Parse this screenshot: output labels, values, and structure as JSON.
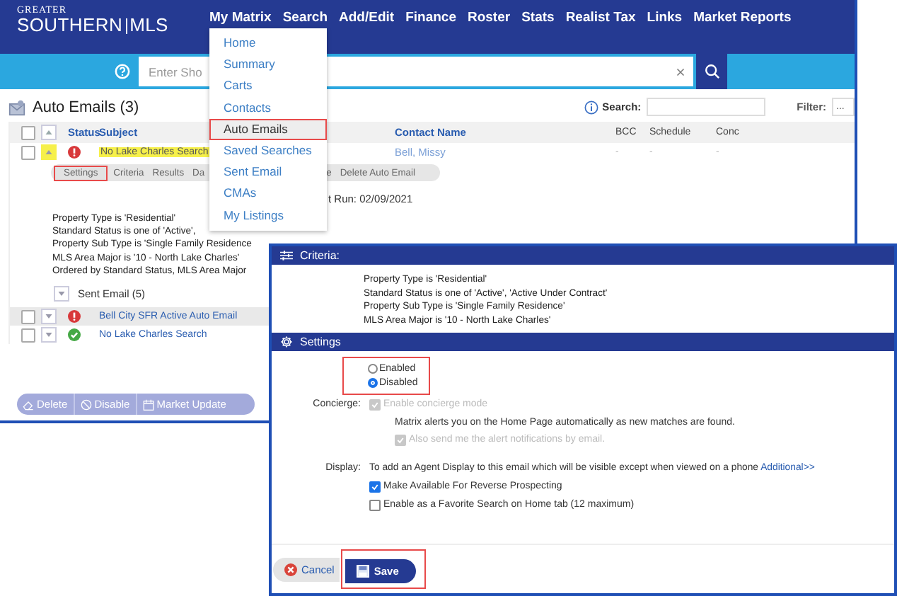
{
  "header": {
    "logo_top": "GREATER",
    "logo_main": "SOUTHERN",
    "logo_suffix": "MLS",
    "nav": [
      "My Matrix",
      "Search",
      "Add/Edit",
      "Finance",
      "Roster",
      "Stats",
      "Realist Tax",
      "Links",
      "Market Reports"
    ]
  },
  "search_bar": {
    "placeholder": "Enter Sho"
  },
  "menu": {
    "items": [
      {
        "label": "Home",
        "selected": false
      },
      {
        "label": "Summary",
        "selected": false
      },
      {
        "label": "Carts",
        "selected": false
      },
      {
        "label": "Contacts",
        "selected": false
      },
      {
        "label": "Auto Emails",
        "selected": true
      },
      {
        "label": "Saved Searches",
        "selected": false
      },
      {
        "label": "Sent Email",
        "selected": false
      },
      {
        "label": "CMAs",
        "selected": false
      },
      {
        "label": "My Listings",
        "selected": false
      }
    ]
  },
  "page": {
    "title": "Auto Emails (3)",
    "search_label": "Search:",
    "filter_label": "Filter:",
    "filter_value": "...",
    "select_all": {
      "checked": false
    },
    "columns": [
      "Status",
      "Subject",
      "Contact Name",
      "BCC",
      "Schedule",
      "Conc"
    ],
    "rows": [
      {
        "kind": "error",
        "subject": "No Lake Charles Search",
        "contact": "Bell, Missy",
        "bcc": "-",
        "schedule": "-",
        "column_6": "-",
        "highlighted": true,
        "expanded": true,
        "selected": false,
        "checked": false
      },
      {
        "kind": "error",
        "subject": "Bell City SFR Active Auto Email",
        "highlighted": false,
        "expanded": false,
        "selected": true,
        "checked": false
      },
      {
        "kind": "ok",
        "subject": "No Lake Charles Search",
        "highlighted": false,
        "expanded": false,
        "selected": false,
        "checked": false
      }
    ],
    "detail": {
      "tabs": [
        {
          "label": "Settings",
          "selected": true
        },
        {
          "label": "Criteria",
          "selected": false
        },
        {
          "label": "Results",
          "selected": false
        },
        {
          "label": "Da",
          "selected": false
        }
      ],
      "tabs_after": [
        {
          "label": "e",
          "selected": false
        },
        {
          "label": "Delete Auto Email",
          "selected": false
        }
      ],
      "last_run": "t Run: 02/09/2021",
      "criteria": [
        "Property Type is 'Residential'",
        "Standard Status is one of 'Active',",
        "Property Sub Type is 'Single Family Residence",
        "MLS Area Major is '10 - North Lake Charles'",
        "Ordered by Standard Status, MLS Area Major"
      ],
      "sent_email": "Sent Email (5)"
    },
    "actions": [
      {
        "label": "Delete",
        "kind": "delete"
      },
      {
        "label": "Disable",
        "kind": "disable"
      },
      {
        "label": "Market Update",
        "kind": "calendar"
      }
    ]
  },
  "dialog": {
    "criteria_title": "Criteria:",
    "criteria": [
      "Property Type is 'Residential'",
      "Standard Status is one of 'Active', 'Active Under Contract'",
      "Property Sub Type is 'Single Family Residence'",
      "MLS Area Major is '10 - North Lake Charles'"
    ],
    "settings_title": "Settings",
    "radio_group": {
      "annotated": true,
      "options": [
        {
          "label": "Enabled",
          "selected": false
        },
        {
          "label": "Disabled",
          "selected": true
        }
      ]
    },
    "concierge": {
      "label": "Concierge:",
      "checkbox": {
        "label": "Enable concierge mode",
        "checked": true,
        "disabled": true
      },
      "note": "Matrix alerts you on the Home Page automatically as new matches are found.",
      "sub_checkbox": {
        "label": "Also send me the alert notifications by email.",
        "checked": true,
        "disabled": true
      }
    },
    "display": {
      "label": "Display:",
      "text": "To add an Agent Display to this email which will be visible except when viewed on a phone",
      "link": "Additional>>",
      "checkboxes": [
        {
          "label": "Make Available For Reverse Prospecting",
          "checked": true,
          "disabled": false
        },
        {
          "label": "Enable as a Favorite Search on Home tab (12 maximum)",
          "checked": false,
          "disabled": false
        }
      ]
    },
    "buttons": [
      {
        "label": "Cancel",
        "kind": "cancel",
        "annotated": false
      },
      {
        "label": "Save",
        "kind": "save",
        "annotated": true
      }
    ]
  }
}
